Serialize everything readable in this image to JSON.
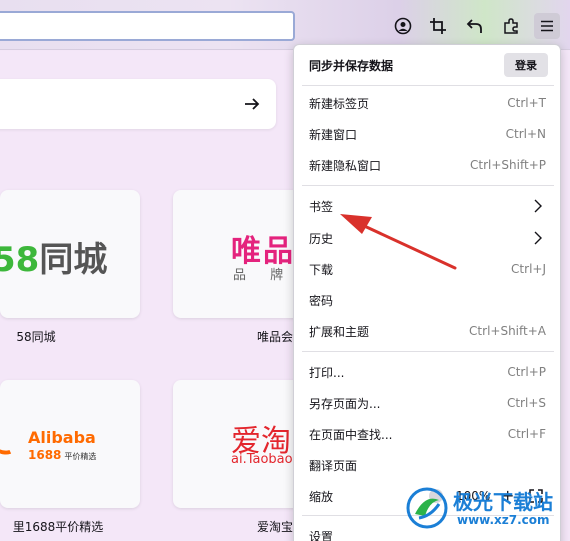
{
  "toolbar": {
    "icons": [
      "account-icon",
      "crop-icon",
      "undo-icon",
      "extensions-icon",
      "hamburger-menu-icon"
    ]
  },
  "tiles": [
    {
      "name": "58同城",
      "logo_digits": "58",
      "logo_text": "同城"
    },
    {
      "name": "唯品会",
      "logo_big": "唯品",
      "logo_small": "品 牌 特"
    },
    {
      "name": "里1688平价精选",
      "logo_line1": "Alibaba",
      "logo_line2": "1688",
      "logo_sub": "平价精选"
    },
    {
      "name": "爱淘宝",
      "logo_big": "爱淘",
      "logo_small": "ai.Taobao"
    }
  ],
  "menu": {
    "title": "同步并保存数据",
    "signin_label": "登录",
    "items": [
      {
        "label": "新建标签页",
        "shortcut": "Ctrl+T"
      },
      {
        "label": "新建窗口",
        "shortcut": "Ctrl+N"
      },
      {
        "label": "新建隐私窗口",
        "shortcut": "Ctrl+Shift+P"
      },
      {
        "label": "书签",
        "shortcut": ""
      },
      {
        "label": "历史",
        "shortcut": ""
      },
      {
        "label": "下载",
        "shortcut": "Ctrl+J"
      },
      {
        "label": "密码",
        "shortcut": ""
      },
      {
        "label": "扩展和主题",
        "shortcut": "Ctrl+Shift+A"
      },
      {
        "label": "打印...",
        "shortcut": "Ctrl+P"
      },
      {
        "label": "另存页面为...",
        "shortcut": "Ctrl+S"
      },
      {
        "label": "在页面中查找...",
        "shortcut": "Ctrl+F"
      },
      {
        "label": "翻译页面",
        "shortcut": ""
      },
      {
        "label": "缩放",
        "shortcut": ""
      },
      {
        "label": "设置",
        "shortcut": ""
      }
    ],
    "zoom": {
      "value": "100%",
      "plus": "+"
    }
  },
  "watermark": {
    "line1": "极光下载站",
    "line2": "www.xz7.com"
  },
  "colors": {
    "arrow": "#d9312b",
    "accent": "#1b7fd6"
  }
}
